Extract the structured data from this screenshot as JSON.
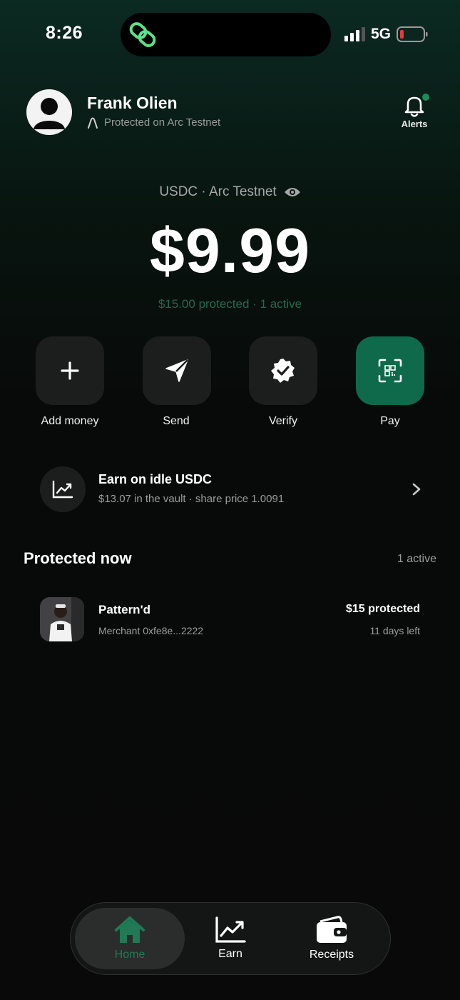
{
  "status_bar": {
    "time": "8:26",
    "network": "5G"
  },
  "user": {
    "name": "Frank Olien",
    "subtitle": "Protected on Arc Testnet"
  },
  "header": {
    "alerts_label": "Alerts"
  },
  "balance": {
    "caption": "USDC · Arc Testnet",
    "amount": "$9.99",
    "protected_line": "$15.00 protected · 1 active"
  },
  "actions": [
    {
      "label": "Add money",
      "icon": "plus-icon"
    },
    {
      "label": "Send",
      "icon": "paper-plane-icon"
    },
    {
      "label": "Verify",
      "icon": "verified-badge-icon"
    },
    {
      "label": "Pay",
      "icon": "qr-scan-icon"
    }
  ],
  "earn": {
    "title": "Earn on idle USDC",
    "subtitle": "$13.07 in the vault · share price 1.0091"
  },
  "protected_now": {
    "title": "Protected now",
    "count": "1 active",
    "items": [
      {
        "merchant": "Pattern'd",
        "address": "Merchant 0xfe8e...2222",
        "amount": "$15 protected",
        "remaining": "11 days left"
      }
    ]
  },
  "nav": {
    "items": [
      {
        "label": "Home",
        "icon": "home-icon",
        "active": true
      },
      {
        "label": "Earn",
        "icon": "chart-icon",
        "active": false
      },
      {
        "label": "Receipts",
        "icon": "wallet-icon",
        "active": false
      }
    ]
  },
  "colors": {
    "accent": "#0e6a4a",
    "accent_text": "#1f6b4d",
    "active_nav": "#1f7a55",
    "alert_dot": "#1f8a5c",
    "battery_low": "#e23b3b"
  }
}
